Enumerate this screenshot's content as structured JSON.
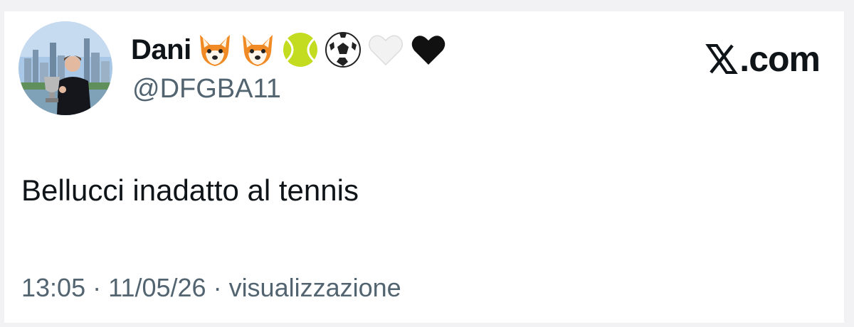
{
  "tweet": {
    "author": {
      "display_name": "Dani",
      "handle": "@DFGBA11",
      "avatar_icon": "avatar",
      "name_emojis": [
        "fox-icon",
        "fox-icon",
        "tennis-ball-icon",
        "soccer-ball-icon",
        "white-heart-icon",
        "black-heart-icon"
      ]
    },
    "brand": {
      "icon": "x-logo-icon",
      "text": ".com"
    },
    "text": "Bellucci inadatto al tennis",
    "meta": {
      "time": "13:05",
      "separator": "·",
      "date": "11/05/26",
      "views_label": "visualizzazione"
    }
  }
}
